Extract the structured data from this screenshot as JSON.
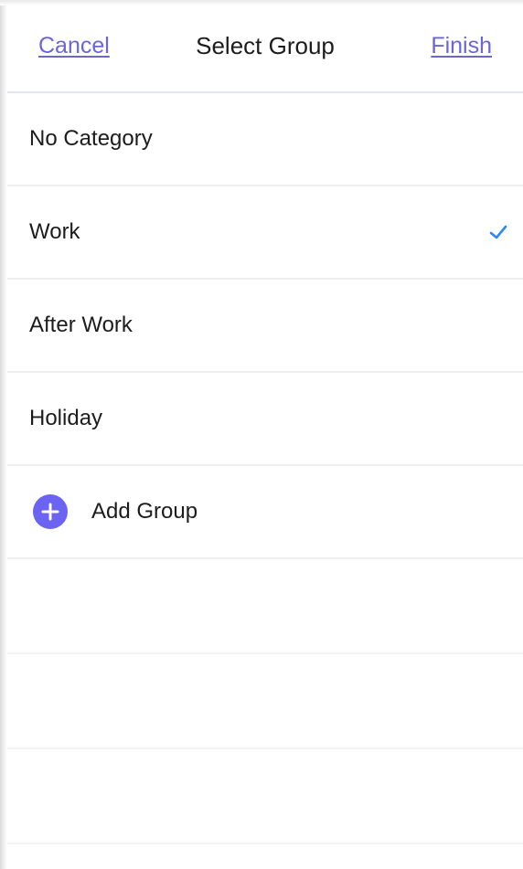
{
  "nav": {
    "cancel_label": "Cancel",
    "title": "Select Group",
    "finish_label": "Finish"
  },
  "groups": [
    {
      "label": "No Category",
      "selected": false
    },
    {
      "label": "Work",
      "selected": true
    },
    {
      "label": "After Work",
      "selected": false
    },
    {
      "label": "Holiday",
      "selected": false
    }
  ],
  "add_group": {
    "label": "Add Group",
    "icon": "plus-circle-icon"
  },
  "icons": {
    "selected": "checkmark-icon"
  },
  "colors": {
    "accent": "#6b66d8",
    "check": "#2f86f5",
    "add_icon_bg": "#6b63f2",
    "text": "#1c1c1e",
    "separator": "#f0f0f2",
    "nav_border": "#e3e2fb"
  }
}
